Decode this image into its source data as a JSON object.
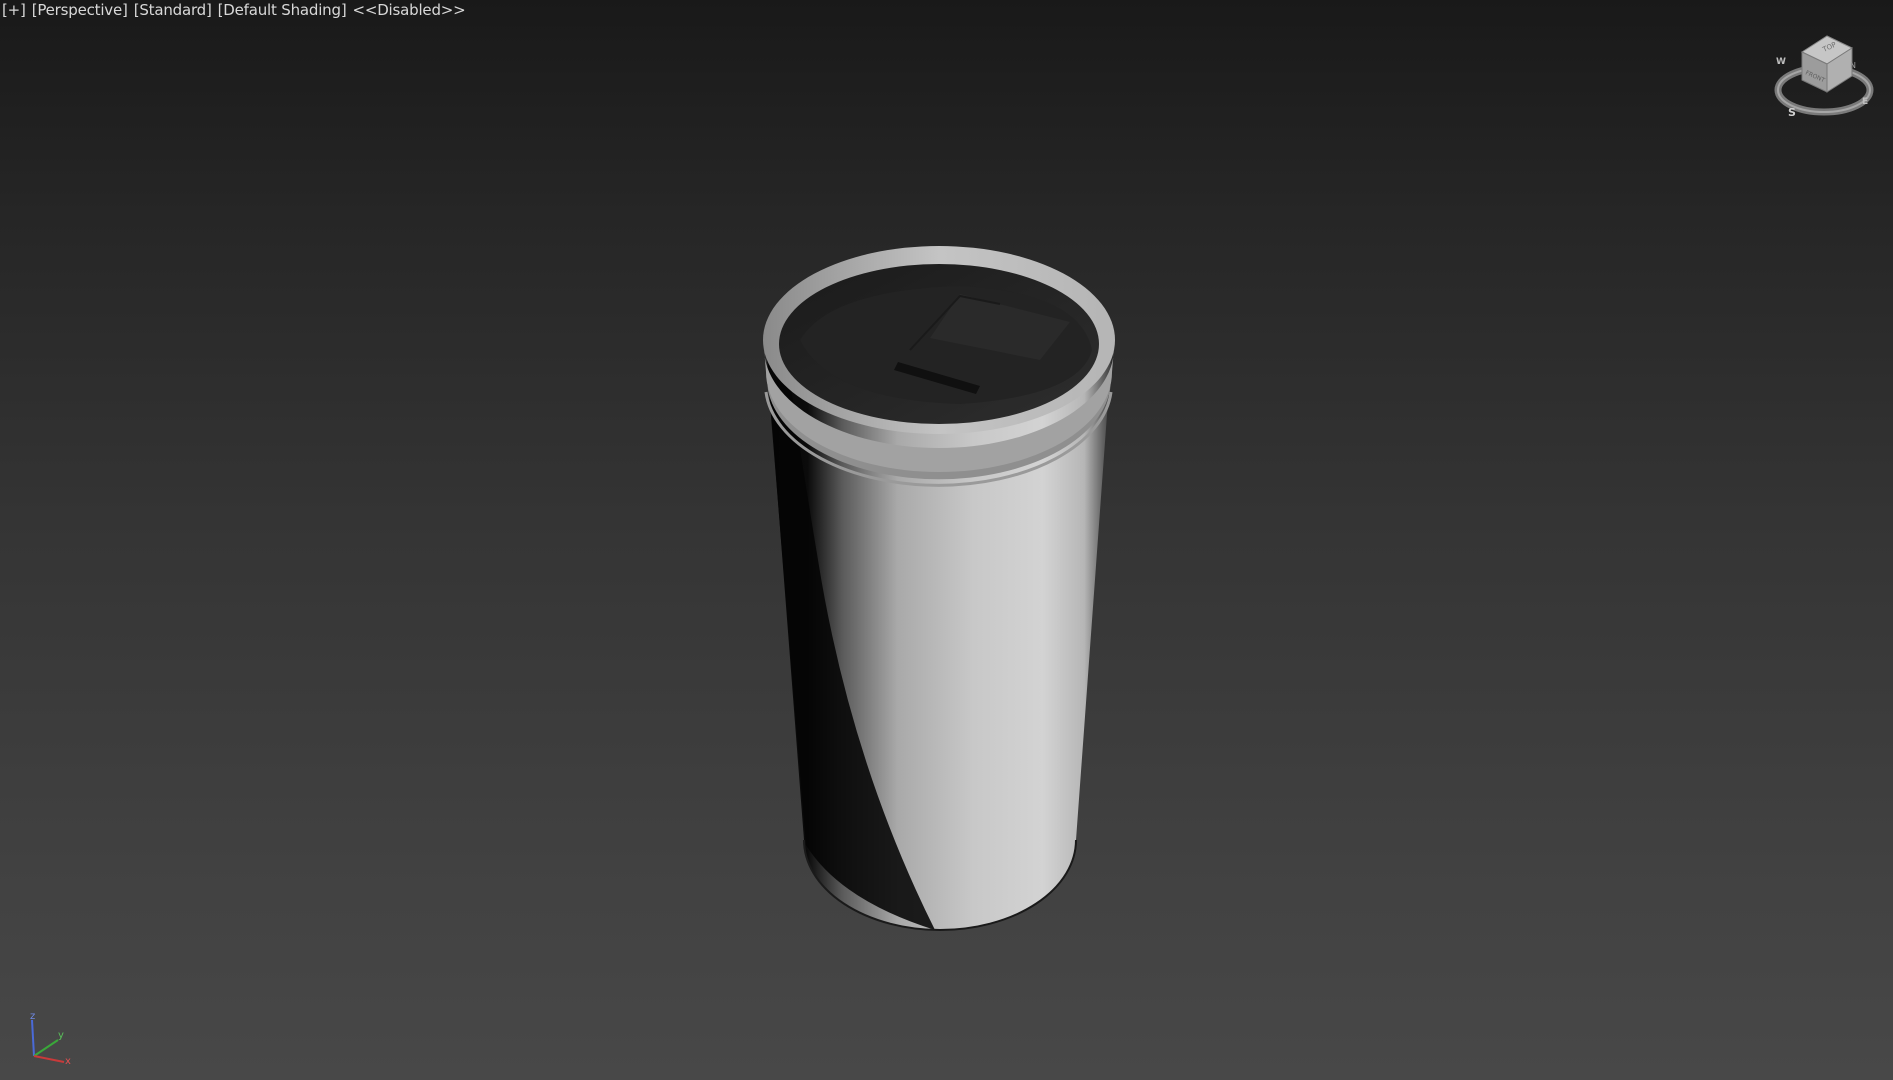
{
  "viewport": {
    "labels": {
      "plus": "+",
      "view": "Perspective",
      "render_mode": "Standard",
      "shading": "Default Shading",
      "status": "<<Disabled>>"
    },
    "viewcube": {
      "top_label": "TOP",
      "front_label": "FRONT",
      "compass": [
        "W",
        "S",
        "E",
        "N"
      ]
    },
    "axis": {
      "x_label": "x",
      "y_label": "y",
      "z_label": "z"
    },
    "colors": {
      "axis_x": "#c83a3a",
      "axis_y": "#3aa83a",
      "axis_z": "#4a6ad8",
      "model_light": "#c9c9c9",
      "model_dark": "#0b0b0b"
    }
  }
}
